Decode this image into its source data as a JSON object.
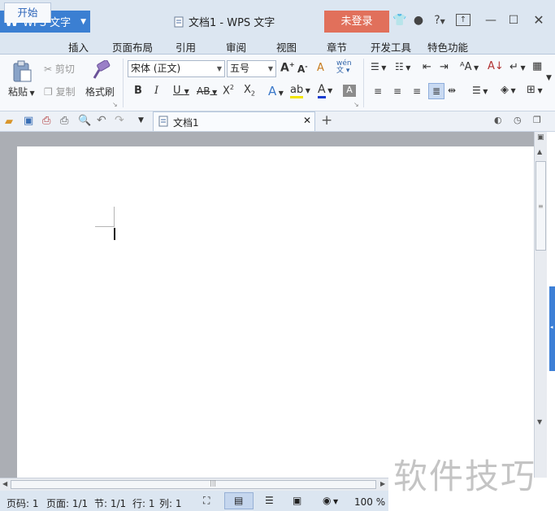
{
  "titlebar": {
    "app_menu_label": "WPS 文字",
    "document_title": "文档1 - WPS 文字",
    "login_button": "未登录",
    "help_label": "?"
  },
  "ribbon_tabs": [
    "开始",
    "插入",
    "页面布局",
    "引用",
    "审阅",
    "视图",
    "章节",
    "开发工具",
    "特色功能"
  ],
  "ribbon": {
    "paste": "粘贴",
    "cut": "剪切",
    "copy": "复制",
    "format_painter": "格式刷",
    "font_name": "宋体 (正文)",
    "font_size": "五号"
  },
  "document_tab": {
    "label": "文档1"
  },
  "statusbar": {
    "page_number": "页码: 1",
    "pages": "页面: 1/1",
    "section": "节: 1/1",
    "row": "行: 1",
    "column": "列: 1",
    "zoom": "100 %"
  },
  "watermark": "软件技巧",
  "colors": {
    "accent_blue": "#3b7fd2",
    "login_orange": "#e1705b",
    "chrome": "#dce6f1"
  }
}
